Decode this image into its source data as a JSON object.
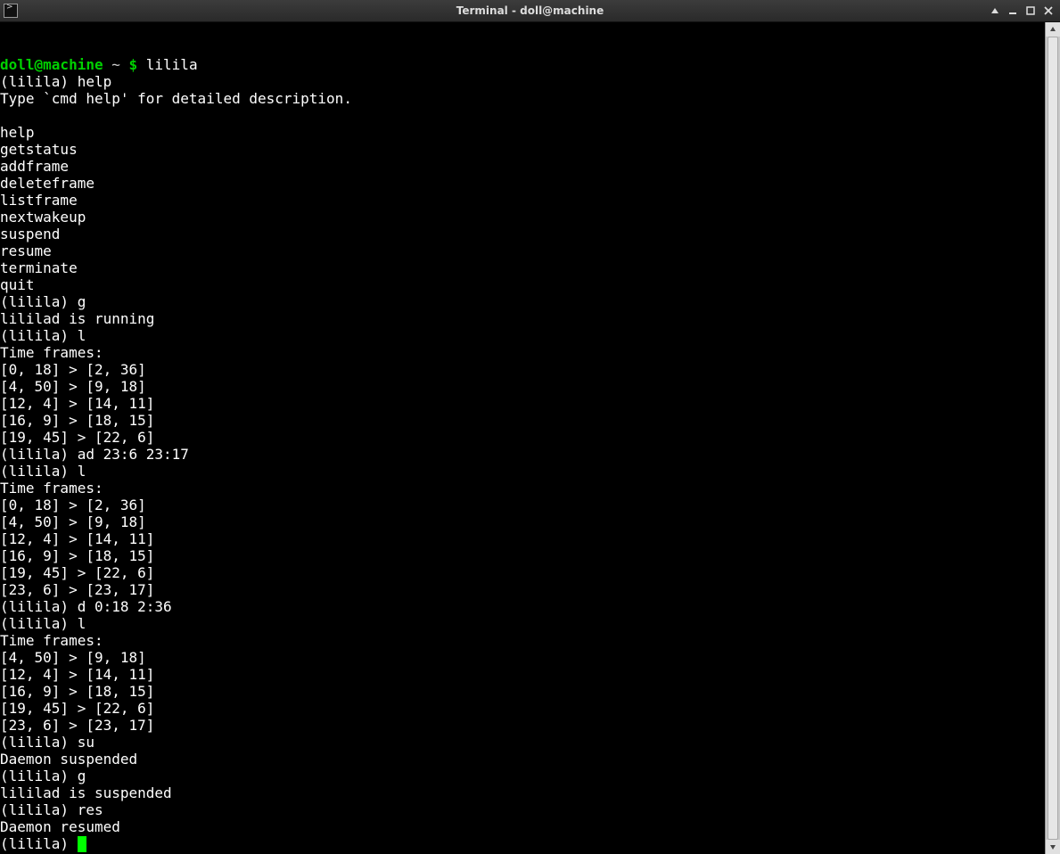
{
  "window": {
    "title": "Terminal - doll@machine"
  },
  "prompt": {
    "userhost": "doll@machine",
    "path": "~",
    "symbol": "$",
    "command": "lilila"
  },
  "session": {
    "repl_prompt": "(lilila)",
    "entries": [
      {
        "in": "help",
        "out": [
          "Type `cmd help' for detailed description.",
          "",
          "help",
          "getstatus",
          "addframe",
          "deleteframe",
          "listframe",
          "nextwakeup",
          "suspend",
          "resume",
          "terminate",
          "quit"
        ]
      },
      {
        "in": "g",
        "out": [
          "lililad is running"
        ]
      },
      {
        "in": "l",
        "out": [
          "Time frames:",
          "[0, 18] > [2, 36]",
          "[4, 50] > [9, 18]",
          "[12, 4] > [14, 11]",
          "[16, 9] > [18, 15]",
          "[19, 45] > [22, 6]"
        ]
      },
      {
        "in": "ad 23:6 23:17",
        "out": []
      },
      {
        "in": "l",
        "out": [
          "Time frames:",
          "[0, 18] > [2, 36]",
          "[4, 50] > [9, 18]",
          "[12, 4] > [14, 11]",
          "[16, 9] > [18, 15]",
          "[19, 45] > [22, 6]",
          "[23, 6] > [23, 17]"
        ]
      },
      {
        "in": "d 0:18 2:36",
        "out": []
      },
      {
        "in": "l",
        "out": [
          "Time frames:",
          "[4, 50] > [9, 18]",
          "[12, 4] > [14, 11]",
          "[16, 9] > [18, 15]",
          "[19, 45] > [22, 6]",
          "[23, 6] > [23, 17]"
        ]
      },
      {
        "in": "su",
        "out": [
          "Daemon suspended"
        ]
      },
      {
        "in": "g",
        "out": [
          "lililad is suspended"
        ]
      },
      {
        "in": "res",
        "out": [
          "Daemon resumed"
        ]
      }
    ]
  }
}
